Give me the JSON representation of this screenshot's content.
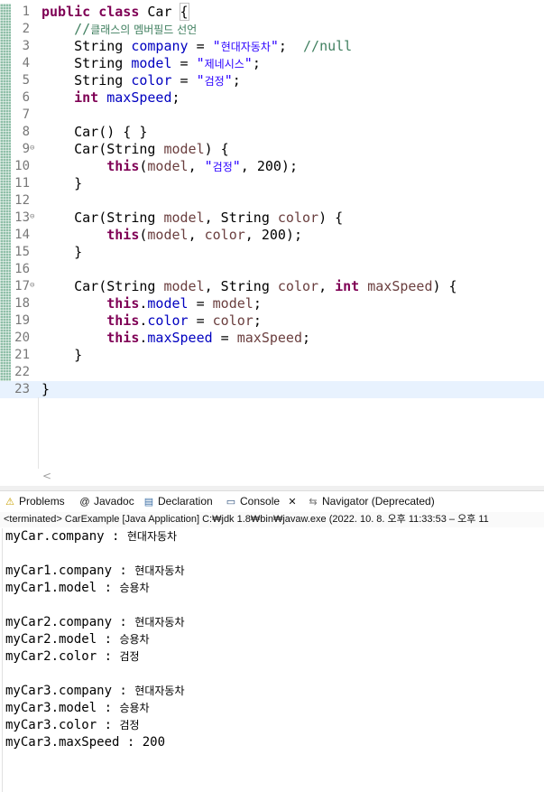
{
  "editor": {
    "code_lines": [
      {
        "n": "1",
        "fold": "",
        "segs": [
          {
            "t": "public",
            "c": "kw"
          },
          {
            "t": " "
          },
          {
            "t": "class",
            "c": "kw"
          },
          {
            "t": " Car "
          },
          {
            "t": "{",
            "c": "brace-box"
          }
        ]
      },
      {
        "n": "2",
        "fold": "",
        "segs": [
          {
            "t": "    "
          },
          {
            "t": "//",
            "c": "cm"
          },
          {
            "t": "클래스의 멤버필드 선언",
            "c": "cm kr"
          }
        ]
      },
      {
        "n": "3",
        "fold": "",
        "segs": [
          {
            "t": "    String "
          },
          {
            "t": "company",
            "c": "fld"
          },
          {
            "t": " = "
          },
          {
            "t": "\"",
            "c": "str"
          },
          {
            "t": "현대자동차",
            "c": "str kr"
          },
          {
            "t": "\"",
            "c": "str"
          },
          {
            "t": ";  "
          },
          {
            "t": "//null",
            "c": "cm"
          }
        ]
      },
      {
        "n": "4",
        "fold": "",
        "segs": [
          {
            "t": "    String "
          },
          {
            "t": "model",
            "c": "fld"
          },
          {
            "t": " = "
          },
          {
            "t": "\"",
            "c": "str"
          },
          {
            "t": "제네시스",
            "c": "str kr"
          },
          {
            "t": "\"",
            "c": "str"
          },
          {
            "t": ";"
          }
        ]
      },
      {
        "n": "5",
        "fold": "",
        "segs": [
          {
            "t": "    String "
          },
          {
            "t": "color",
            "c": "fld"
          },
          {
            "t": " = "
          },
          {
            "t": "\"",
            "c": "str"
          },
          {
            "t": "검정",
            "c": "str kr"
          },
          {
            "t": "\"",
            "c": "str"
          },
          {
            "t": ";"
          }
        ]
      },
      {
        "n": "6",
        "fold": "",
        "segs": [
          {
            "t": "    "
          },
          {
            "t": "int",
            "c": "kw"
          },
          {
            "t": " "
          },
          {
            "t": "maxSpeed",
            "c": "fld"
          },
          {
            "t": ";"
          }
        ]
      },
      {
        "n": "7",
        "fold": "",
        "segs": []
      },
      {
        "n": "8",
        "fold": "",
        "segs": [
          {
            "t": "    Car() { }"
          }
        ]
      },
      {
        "n": "9",
        "fold": "⊖",
        "segs": [
          {
            "t": "    Car(String "
          },
          {
            "t": "model",
            "c": "var"
          },
          {
            "t": ") {"
          }
        ]
      },
      {
        "n": "10",
        "fold": "",
        "segs": [
          {
            "t": "        "
          },
          {
            "t": "this",
            "c": "kw"
          },
          {
            "t": "("
          },
          {
            "t": "model",
            "c": "var"
          },
          {
            "t": ", "
          },
          {
            "t": "\"",
            "c": "str"
          },
          {
            "t": "검정",
            "c": "str kr"
          },
          {
            "t": "\"",
            "c": "str"
          },
          {
            "t": ", 200);"
          }
        ]
      },
      {
        "n": "11",
        "fold": "",
        "segs": [
          {
            "t": "    }"
          }
        ]
      },
      {
        "n": "12",
        "fold": "",
        "segs": []
      },
      {
        "n": "13",
        "fold": "⊖",
        "segs": [
          {
            "t": "    Car(String "
          },
          {
            "t": "model",
            "c": "var"
          },
          {
            "t": ", String "
          },
          {
            "t": "color",
            "c": "var"
          },
          {
            "t": ") {"
          }
        ]
      },
      {
        "n": "14",
        "fold": "",
        "segs": [
          {
            "t": "        "
          },
          {
            "t": "this",
            "c": "kw"
          },
          {
            "t": "("
          },
          {
            "t": "model",
            "c": "var"
          },
          {
            "t": ", "
          },
          {
            "t": "color",
            "c": "var"
          },
          {
            "t": ", 200);"
          }
        ]
      },
      {
        "n": "15",
        "fold": "",
        "segs": [
          {
            "t": "    }"
          }
        ]
      },
      {
        "n": "16",
        "fold": "",
        "segs": []
      },
      {
        "n": "17",
        "fold": "⊖",
        "segs": [
          {
            "t": "    Car(String "
          },
          {
            "t": "model",
            "c": "var"
          },
          {
            "t": ", String "
          },
          {
            "t": "color",
            "c": "var"
          },
          {
            "t": ", "
          },
          {
            "t": "int",
            "c": "kw"
          },
          {
            "t": " "
          },
          {
            "t": "maxSpeed",
            "c": "var"
          },
          {
            "t": ") {"
          }
        ]
      },
      {
        "n": "18",
        "fold": "",
        "segs": [
          {
            "t": "        "
          },
          {
            "t": "this",
            "c": "kw"
          },
          {
            "t": "."
          },
          {
            "t": "model",
            "c": "fld"
          },
          {
            "t": " = "
          },
          {
            "t": "model",
            "c": "var"
          },
          {
            "t": ";"
          }
        ]
      },
      {
        "n": "19",
        "fold": "",
        "segs": [
          {
            "t": "        "
          },
          {
            "t": "this",
            "c": "kw"
          },
          {
            "t": "."
          },
          {
            "t": "color",
            "c": "fld"
          },
          {
            "t": " = "
          },
          {
            "t": "color",
            "c": "var"
          },
          {
            "t": ";"
          }
        ]
      },
      {
        "n": "20",
        "fold": "",
        "segs": [
          {
            "t": "        "
          },
          {
            "t": "this",
            "c": "kw"
          },
          {
            "t": "."
          },
          {
            "t": "maxSpeed",
            "c": "fld"
          },
          {
            "t": " = "
          },
          {
            "t": "maxSpeed",
            "c": "var"
          },
          {
            "t": ";"
          }
        ]
      },
      {
        "n": "21",
        "fold": "",
        "segs": [
          {
            "t": "    }"
          }
        ]
      },
      {
        "n": "22",
        "fold": "",
        "segs": []
      },
      {
        "n": "23",
        "fold": "",
        "segs": [
          {
            "t": "}"
          }
        ],
        "current": true
      }
    ],
    "scroll_left_glyph": "<"
  },
  "tabs": [
    {
      "id": "problems",
      "icon": "⚠",
      "label": "Problems"
    },
    {
      "id": "javadoc",
      "icon": "@",
      "label": "Javadoc"
    },
    {
      "id": "declaration",
      "icon": "▤",
      "label": "Declaration"
    },
    {
      "id": "console",
      "icon": "▭",
      "label": "Console",
      "close": "✕"
    },
    {
      "id": "navigator",
      "icon": "⇆",
      "label": "Navigator (Deprecated)"
    }
  ],
  "status": "<terminated> CarExample [Java Application] C:₩jdk 1.8₩bin₩javaw.exe  (2022. 10. 8. 오후 11:33:53 – 오후 11",
  "console": {
    "lines": [
      {
        "a": "myCar.company : ",
        "b": "현대자동차"
      },
      {
        "a": "",
        "b": ""
      },
      {
        "a": "myCar1.company : ",
        "b": "현대자동차"
      },
      {
        "a": "myCar1.model : ",
        "b": "승용차"
      },
      {
        "a": "",
        "b": ""
      },
      {
        "a": "myCar2.company : ",
        "b": "현대자동차"
      },
      {
        "a": "myCar2.model : ",
        "b": "승용차"
      },
      {
        "a": "myCar2.color : ",
        "b": "검정"
      },
      {
        "a": "",
        "b": ""
      },
      {
        "a": "myCar3.company : ",
        "b": "현대자동차"
      },
      {
        "a": "myCar3.model : ",
        "b": "승용차"
      },
      {
        "a": "myCar3.color : ",
        "b": "검정"
      },
      {
        "a": "myCar3.maxSpeed : 200",
        "b": ""
      }
    ]
  },
  "colors": {
    "keyword": "#7f0055",
    "field": "#0000c0",
    "string": "#2a00ff",
    "comment": "#3f7f5f",
    "local_var": "#6a3e3e",
    "current_line": "#e8f2fe"
  }
}
